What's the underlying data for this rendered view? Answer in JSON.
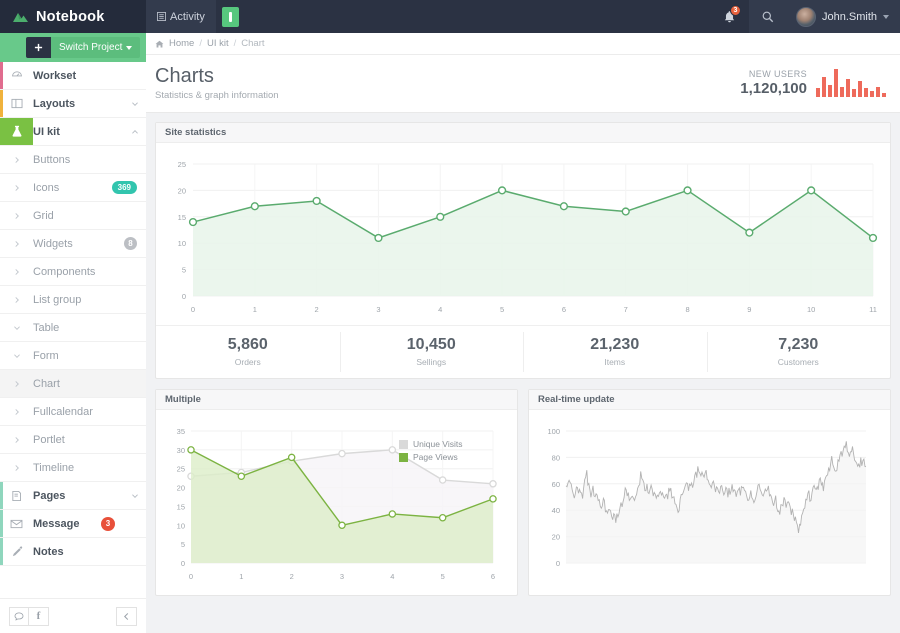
{
  "navbar": {
    "brand": "Notebook",
    "brand_icon": "mountain-logo-icon",
    "activity_tab": "Activity",
    "activity_icon": "list-icon",
    "green_tile_icon": "bookmark-icon",
    "bell_icon": "bell-icon",
    "bell_badge": "3",
    "search_icon": "search-icon",
    "user_name": "John.Smith",
    "avatar_icon": "user-avatar",
    "caret_icon": "chevron-down-icon"
  },
  "sidebar": {
    "switch_project": "Switch Project",
    "plus_icon": "plus-icon",
    "items": [
      {
        "label": "Workset",
        "icon": "dashboard-icon",
        "type": "main",
        "accent": "#e06c8e",
        "chevron": ""
      },
      {
        "label": "Layouts",
        "icon": "layout-icon",
        "type": "main",
        "accent": "#f0b23c",
        "chevron": "down"
      },
      {
        "label": "UI kit",
        "icon": "flask-icon",
        "type": "main",
        "accent": "#7ac143",
        "chevron": "up",
        "selected": true
      },
      {
        "label": "Buttons",
        "icon": "chevron-right",
        "type": "sub"
      },
      {
        "label": "Icons",
        "icon": "chevron-right",
        "type": "sub",
        "badge": "369",
        "badge_style": "teal"
      },
      {
        "label": "Grid",
        "icon": "chevron-right",
        "type": "sub"
      },
      {
        "label": "Widgets",
        "icon": "chevron-right",
        "type": "sub",
        "badge": "8",
        "badge_style": "grey"
      },
      {
        "label": "Components",
        "icon": "chevron-right",
        "type": "sub"
      },
      {
        "label": "List group",
        "icon": "chevron-right",
        "type": "sub"
      },
      {
        "label": "Table",
        "icon": "chevron-down",
        "type": "sub"
      },
      {
        "label": "Form",
        "icon": "chevron-down",
        "type": "sub"
      },
      {
        "label": "Chart",
        "icon": "chevron-right",
        "type": "sub",
        "active": true
      },
      {
        "label": "Fullcalendar",
        "icon": "chevron-right",
        "type": "sub"
      },
      {
        "label": "Portlet",
        "icon": "chevron-right",
        "type": "sub"
      },
      {
        "label": "Timeline",
        "icon": "chevron-right",
        "type": "sub"
      },
      {
        "label": "Pages",
        "icon": "book-icon",
        "type": "main",
        "accent": "#8fd6bd",
        "chevron": "down"
      },
      {
        "label": "Message",
        "icon": "envelope-icon",
        "type": "main",
        "accent": "#8fd6bd",
        "badge": "3",
        "badge_style": "red"
      },
      {
        "label": "Notes",
        "icon": "pencil-icon",
        "type": "main",
        "accent": "#8fd6bd"
      }
    ],
    "footer": {
      "chat_icon": "chat-bubble-icon",
      "facebook_icon": "facebook-icon",
      "collapse_icon": "chevron-left-icon"
    }
  },
  "breadcrumb": {
    "home_icon": "home-icon",
    "items": [
      "Home",
      "UI kit",
      "Chart"
    ],
    "separator": "/"
  },
  "page": {
    "title": "Charts",
    "subtitle": "Statistics & graph information",
    "new_users_label": "NEW USERS",
    "new_users_value": "1,120,100",
    "new_users_color": "#ee6a5b",
    "sparkline": [
      9,
      20,
      12,
      28,
      10,
      18,
      8,
      16,
      9,
      6,
      10,
      4
    ]
  },
  "panels": {
    "site_statistics": "Site statistics",
    "multiple": "Multiple",
    "realtime": "Real-time update"
  },
  "stats": [
    {
      "value": "5,860",
      "label": "Orders"
    },
    {
      "value": "10,450",
      "label": "Sellings"
    },
    {
      "value": "21,230",
      "label": "Items"
    },
    {
      "value": "7,230",
      "label": "Customers"
    }
  ],
  "chart_data": [
    {
      "id": "site-statistics",
      "type": "area",
      "title": "Site statistics",
      "x": [
        0,
        1,
        2,
        3,
        4,
        5,
        6,
        7,
        8,
        9,
        10,
        11
      ],
      "values": [
        14,
        17,
        18,
        11,
        15,
        20,
        17,
        16,
        20,
        12,
        20,
        11
      ],
      "xlabel": "",
      "ylabel": "",
      "xlim": [
        0,
        11
      ],
      "ylim": [
        0,
        25
      ],
      "yticks": [
        0,
        5,
        10,
        15,
        20,
        25
      ],
      "xticks": [
        0,
        1,
        2,
        3,
        4,
        5,
        6,
        7,
        8,
        9,
        10,
        11
      ],
      "grid": true,
      "legend": "none",
      "line_color": "#5aab6e",
      "fill_color": "#e8f4ea",
      "marker": "open-circle"
    },
    {
      "id": "multiple",
      "type": "area",
      "title": "Multiple",
      "x": [
        0,
        1,
        2,
        3,
        4,
        5,
        6
      ],
      "series": [
        {
          "name": "Unique Visits",
          "values": [
            23,
            24,
            27,
            29,
            30,
            22,
            21
          ],
          "color": "#d9d9d9",
          "fill": "#f6f4f8"
        },
        {
          "name": "Page Views",
          "values": [
            30,
            23,
            28,
            10,
            13,
            12,
            17
          ],
          "color": "#7cb342",
          "fill": "#dcedc8"
        }
      ],
      "xlabel": "",
      "ylabel": "",
      "xlim": [
        0,
        6
      ],
      "ylim": [
        0,
        35
      ],
      "yticks": [
        0,
        5,
        10,
        15,
        20,
        25,
        30,
        35
      ],
      "xticks": [
        0,
        1,
        2,
        3,
        4,
        5,
        6
      ],
      "grid": true,
      "legend": "top-right"
    },
    {
      "id": "realtime",
      "type": "line",
      "title": "Real-time update",
      "ylim": [
        0,
        100
      ],
      "yticks": [
        0,
        20,
        40,
        60,
        80,
        100
      ],
      "xticks": [],
      "grid": true,
      "legend": "none",
      "line_color": "#b3b3b3",
      "fill_color": "#f4f4f4",
      "note": "noisy random-walk series, range approx 25-90",
      "values": [
        62,
        58,
        64,
        55,
        50,
        58,
        52,
        56,
        50,
        63,
        67,
        58,
        52,
        55,
        48,
        52,
        45,
        42,
        48,
        40,
        36,
        40,
        34,
        38,
        33,
        36,
        42,
        46,
        52,
        56,
        50,
        47,
        52,
        48,
        54,
        58,
        66,
        60,
        55,
        58,
        52,
        56,
        51,
        54,
        50,
        51,
        53,
        50,
        54,
        51,
        56,
        52,
        48,
        44,
        39,
        46,
        52,
        58,
        62,
        57,
        61,
        60,
        64,
        68,
        72,
        69,
        66,
        70,
        64,
        61,
        58,
        62,
        56,
        60,
        55,
        58,
        54,
        56,
        52,
        55,
        58,
        56,
        53,
        57,
        54,
        58,
        55,
        52,
        48,
        52,
        46,
        50,
        54,
        58,
        52,
        49,
        53,
        58,
        54,
        50,
        45,
        48,
        42,
        39,
        44,
        47,
        43,
        46,
        41,
        38,
        34,
        30,
        26,
        32,
        38,
        42,
        48,
        52,
        48,
        54,
        58,
        56,
        60,
        62,
        58,
        63,
        68,
        72,
        78,
        74,
        70,
        76,
        80,
        84,
        88,
        90,
        86,
        82,
        86,
        80,
        76,
        73,
        78,
        75,
        76
      ]
    }
  ]
}
